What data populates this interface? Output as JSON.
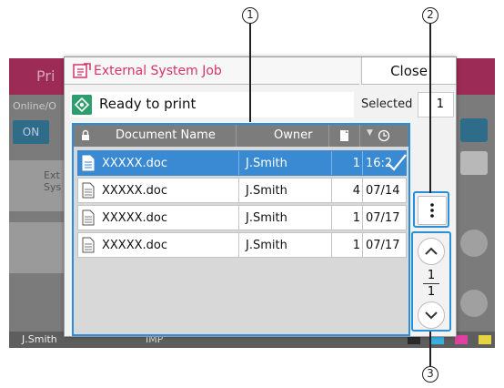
{
  "callouts": [
    "1",
    "2",
    "3"
  ],
  "background": {
    "header_title": "Pri",
    "online_label": "Online/O",
    "on_button": "ON",
    "ext_label": "Ext Sys",
    "footer_user": "J.Smith",
    "footer_mid": "IMP",
    "ink_labels": [
      "K",
      "C",
      "M",
      "Y"
    ],
    "colors": {
      "header": "#9c2b55",
      "on_button": "#2e6c8a"
    }
  },
  "dialog": {
    "title": "External System Job",
    "close_label": "Close",
    "status_text": "Ready to print",
    "selected_label": "Selected",
    "selected_count": "1",
    "colors": {
      "title_text": "#d6336c",
      "highlight": "#2a8fd9",
      "selected_row": "#3a8ad3",
      "status_icon": "#2f9e6e"
    }
  },
  "table": {
    "columns": [
      "Document Name",
      "Owner"
    ],
    "rows": [
      {
        "name": "XXXXX.doc",
        "owner": "J.Smith",
        "pages": "1",
        "date": "16:2",
        "selected": true
      },
      {
        "name": "XXXXX.doc",
        "owner": "J.Smith",
        "pages": "4",
        "date": "07/14",
        "selected": false
      },
      {
        "name": "XXXXX.doc",
        "owner": "J.Smith",
        "pages": "1",
        "date": "07/17",
        "selected": false
      },
      {
        "name": "XXXXX.doc",
        "owner": "J.Smith",
        "pages": "1",
        "date": "07/17",
        "selected": false
      }
    ]
  },
  "controls": {
    "menu_icon": "vertical-dots-icon",
    "page_current": "1",
    "page_total": "1"
  }
}
